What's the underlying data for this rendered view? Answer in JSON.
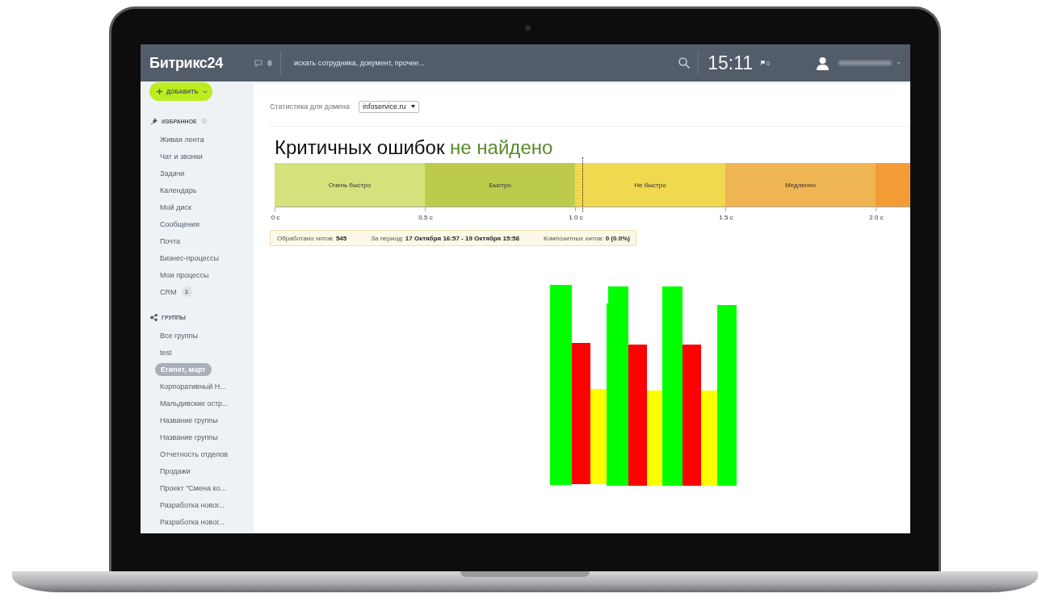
{
  "topbar": {
    "logo": "Битрикс24",
    "search": {
      "placeholder": "искать сотрудника, документ, прочее..."
    },
    "time": "15:11",
    "flag_count": "0"
  },
  "sidebar": {
    "add_button": "ДОБАВИТЬ",
    "sections": [
      {
        "kind": "favorites",
        "title": "ИЗБРАННОЕ",
        "items": [
          {
            "label": "Живая лента",
            "selected": false
          },
          {
            "label": "Чат и звонки",
            "selected": false
          },
          {
            "label": "Задачи",
            "selected": false
          },
          {
            "label": "Календарь",
            "selected": false
          },
          {
            "label": "Мой диск",
            "selected": false
          },
          {
            "label": "Сообщения",
            "selected": false
          },
          {
            "label": "Почта",
            "selected": false
          },
          {
            "label": "Бизнес-процессы",
            "selected": false
          },
          {
            "label": "Мои процессы",
            "selected": false
          },
          {
            "label": "CRM",
            "selected": false,
            "counter": "1"
          }
        ]
      },
      {
        "kind": "groups",
        "title": "ГРУППЫ",
        "items": [
          {
            "label": "Все группы",
            "selected": false
          },
          {
            "label": "test",
            "selected": false
          },
          {
            "label": "Египет, март",
            "selected": true
          },
          {
            "label": "Корпоративный Н...",
            "selected": false
          },
          {
            "label": "Мальдивские остр...",
            "selected": false
          },
          {
            "label": "Название группы",
            "selected": false
          },
          {
            "label": "Название группы",
            "selected": false
          },
          {
            "label": "Отчетность отделов",
            "selected": false
          },
          {
            "label": "Продажи",
            "selected": false
          },
          {
            "label": "Проект \"Смена ко...",
            "selected": false
          },
          {
            "label": "Разработка новог...",
            "selected": false
          },
          {
            "label": "Разработка новог...",
            "selected": false
          }
        ]
      }
    ]
  },
  "content": {
    "domain_label": "Статистика для домена",
    "domain_select": "infoservice.ru",
    "heading": {
      "text": "Критичных ошибок",
      "status": "не найдено"
    },
    "speed_scale": {
      "segments": [
        {
          "label": "Очень быстро",
          "color": "#d5e17a"
        },
        {
          "label": "Быстро",
          "color": "#bccb4b"
        },
        {
          "label": "Не быстро",
          "color": "#f0d84f"
        },
        {
          "label": "Медленно",
          "color": "#f0b553"
        },
        {
          "color": "#f39c35"
        }
      ],
      "ticks": [
        "0 с",
        "0.5 с",
        "1.0 с",
        "1.5 с",
        "2.0 с"
      ],
      "marker": {
        "level": 0.484
      }
    },
    "stats": [
      {
        "label": "Обработано хитов:",
        "value": "545"
      },
      {
        "label": "За период:",
        "value": "17 Октября 16:57 - 19 Октября 15:58"
      },
      {
        "label": "Композитных хитов:",
        "value": "0 (0.0%)"
      }
    ]
  }
}
